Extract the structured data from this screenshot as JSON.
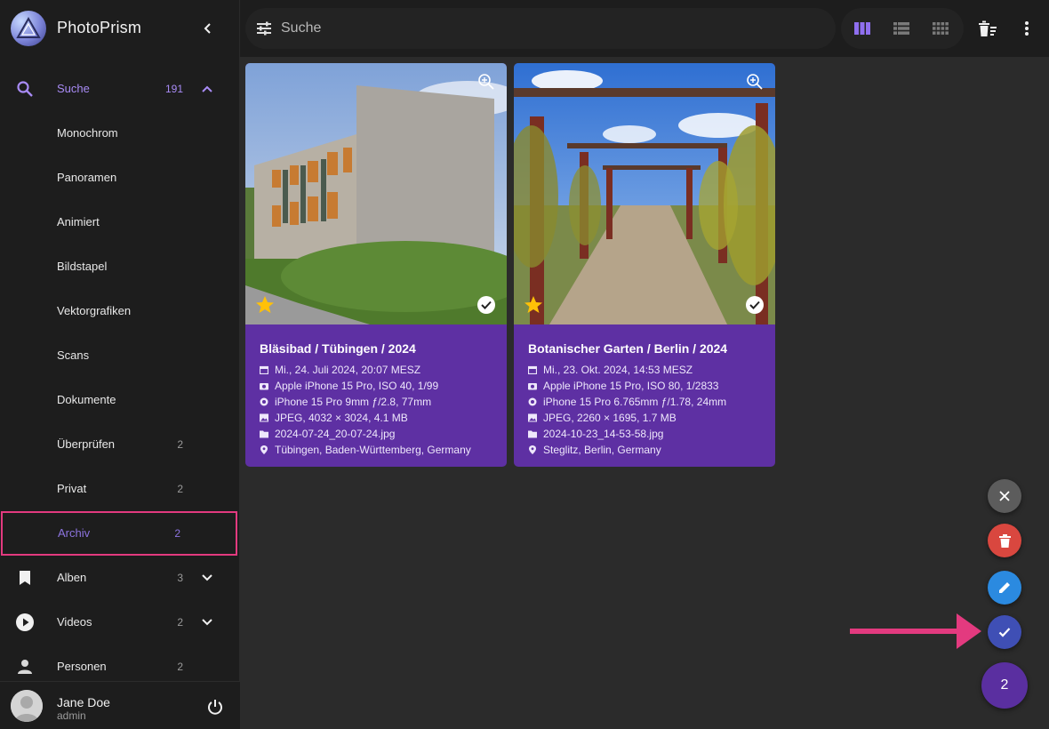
{
  "app": {
    "title": "PhotoPrism"
  },
  "sidebar": {
    "items": [
      {
        "label": "Suche",
        "count": "191",
        "icon": "search-icon"
      },
      {
        "label": "Monochrom",
        "count": ""
      },
      {
        "label": "Panoramen",
        "count": ""
      },
      {
        "label": "Animiert",
        "count": ""
      },
      {
        "label": "Bildstapel",
        "count": ""
      },
      {
        "label": "Vektorgrafiken",
        "count": ""
      },
      {
        "label": "Scans",
        "count": ""
      },
      {
        "label": "Dokumente",
        "count": ""
      },
      {
        "label": "Überprüfen",
        "count": "2"
      },
      {
        "label": "Privat",
        "count": "2"
      },
      {
        "label": "Archiv",
        "count": "2"
      },
      {
        "label": "Alben",
        "count": "3",
        "icon": "bookmark-icon"
      },
      {
        "label": "Videos",
        "count": "2",
        "icon": "play-circle-icon"
      },
      {
        "label": "Personen",
        "count": "2",
        "icon": "person-icon"
      }
    ],
    "user": {
      "name": "Jane Doe",
      "role": "admin"
    }
  },
  "search": {
    "placeholder": "Suche"
  },
  "cards": [
    {
      "title": "Bläsibad / Tübingen / 2024",
      "date": "Mi., 24. Juli 2024, 20:07 MESZ",
      "camera": "Apple iPhone 15 Pro, ISO 40, 1/99",
      "lens": "iPhone 15 Pro 9mm ƒ/2.8, 77mm",
      "file": "JPEG, 4032 × 3024, 4.1 MB",
      "filename": "2024-07-24_20-07-24.jpg",
      "location": "Tübingen, Baden-Württemberg, Germany"
    },
    {
      "title": "Botanischer Garten / Berlin / 2024",
      "date": "Mi., 23. Okt. 2024, 14:53 MESZ",
      "camera": "Apple iPhone 15 Pro, ISO 80, 1/2833",
      "lens": "iPhone 15 Pro 6.765mm ƒ/1.78, 24mm",
      "file": "JPEG, 2260 × 1695, 1.7 MB",
      "filename": "2024-10-23_14-53-58.jpg",
      "location": "Steglitz, Berlin, Germany"
    }
  ],
  "selection": {
    "count": "2"
  },
  "colors": {
    "accent": "#5e30a3",
    "highlight_border": "#e33a7f",
    "fab_close": "#5c5c5c",
    "fab_delete": "#d9473f",
    "fab_edit": "#2b8ae0",
    "fab_confirm": "#3f4fb5",
    "star": "#ffc107"
  }
}
